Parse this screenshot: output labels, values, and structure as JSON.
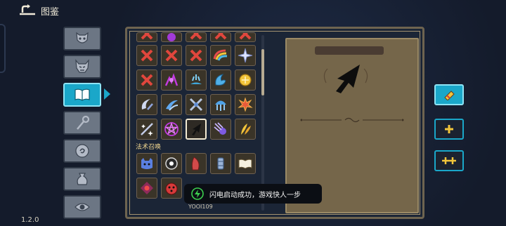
{
  "header": {
    "title": "图鉴"
  },
  "version": "1.2.0",
  "tabs": [
    {
      "name": "tab-mask",
      "icon": "mask-icon",
      "active": false
    },
    {
      "name": "tab-demon",
      "icon": "demon-icon",
      "active": false
    },
    {
      "name": "tab-book",
      "icon": "book-icon",
      "active": true
    },
    {
      "name": "tab-staff",
      "icon": "staff-icon",
      "active": false
    },
    {
      "name": "tab-scroll",
      "icon": "scroll-icon",
      "active": false
    },
    {
      "name": "tab-bag",
      "icon": "bag-icon",
      "active": false
    },
    {
      "name": "tab-eye",
      "icon": "eye-icon",
      "active": false
    }
  ],
  "grid": {
    "section_label": "法术召唤",
    "row_partial": [
      "red-x-icon",
      "purple-icon",
      "red-x-icon",
      "red-x-icon",
      "red-x-icon"
    ],
    "row1": [
      "red-x-icon",
      "red-x-icon",
      "red-x-icon",
      "rainbow-icon",
      "sparkle-icon"
    ],
    "row2": [
      "red-x-icon",
      "purple-sigil-icon",
      "splash-icon",
      "wave-icon",
      "gold-orb-icon"
    ],
    "row3": [
      "crescent-slash-icon",
      "blue-slash-icon",
      "crossed-blades-icon",
      "jellyfish-icon",
      "fire-burst-icon"
    ],
    "row4": [
      "star-slash-icon",
      "pentagram-icon",
      "cursor-icon",
      "comet-icon",
      "gold-feather-icon"
    ],
    "row5": [
      "blue-cat-icon",
      "eye-orb-icon",
      "red-fang-icon",
      "canister-icon",
      "open-book-icon"
    ],
    "row6": [
      "red-eye-icon",
      "red-ladybug-icon"
    ]
  },
  "detail": {
    "icon": "cursor-icon"
  },
  "side_buttons": [
    {
      "name": "side-button-flask",
      "icon": "flask-icon",
      "active": true
    },
    {
      "name": "side-button-plus",
      "icon": "plus-icon",
      "active": false
    },
    {
      "name": "side-button-double-plus",
      "icon": "double-plus-icon",
      "active": false
    }
  ],
  "toast": {
    "text": "闪电启动成功，游戏快人一步",
    "icon": "lightning-icon"
  },
  "hint": "YOOI109",
  "colors": {
    "accent": "#1aa7c9",
    "parchment": "#75664a",
    "frame": "#6e6450",
    "toast_green": "#3ccf4e"
  }
}
